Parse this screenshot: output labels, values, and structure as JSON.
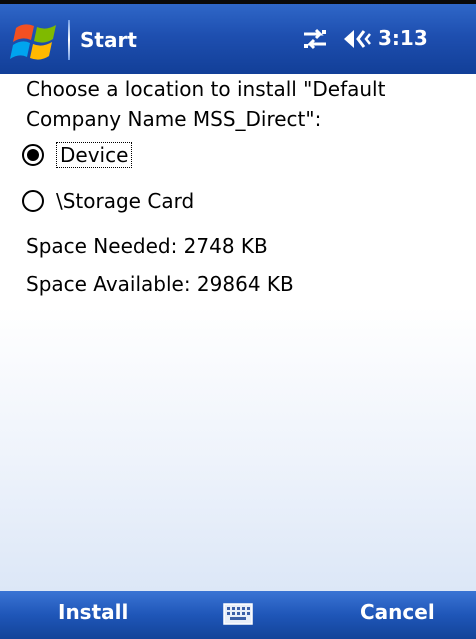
{
  "titlebar": {
    "start_label": "Start",
    "time": "3:13"
  },
  "main": {
    "prompt": "Choose a location to install \"Default Company Name MSS_Direct\":",
    "options": [
      {
        "label": "Device",
        "selected": true
      },
      {
        "label": "\\Storage Card",
        "selected": false
      }
    ],
    "space_needed": "Space Needed:  2748 KB",
    "space_available": "Space Available: 29864 KB"
  },
  "menubar": {
    "left_softkey": "Install",
    "right_softkey": "Cancel"
  },
  "icons": {
    "start": "windows-flag-icon",
    "connectivity": "connectivity-icon",
    "volume": "volume-icon",
    "keyboard": "keyboard-icon"
  },
  "colors": {
    "titlebar": "#1e4fb0",
    "menubar": "#1f56b8",
    "text": "#000000"
  }
}
